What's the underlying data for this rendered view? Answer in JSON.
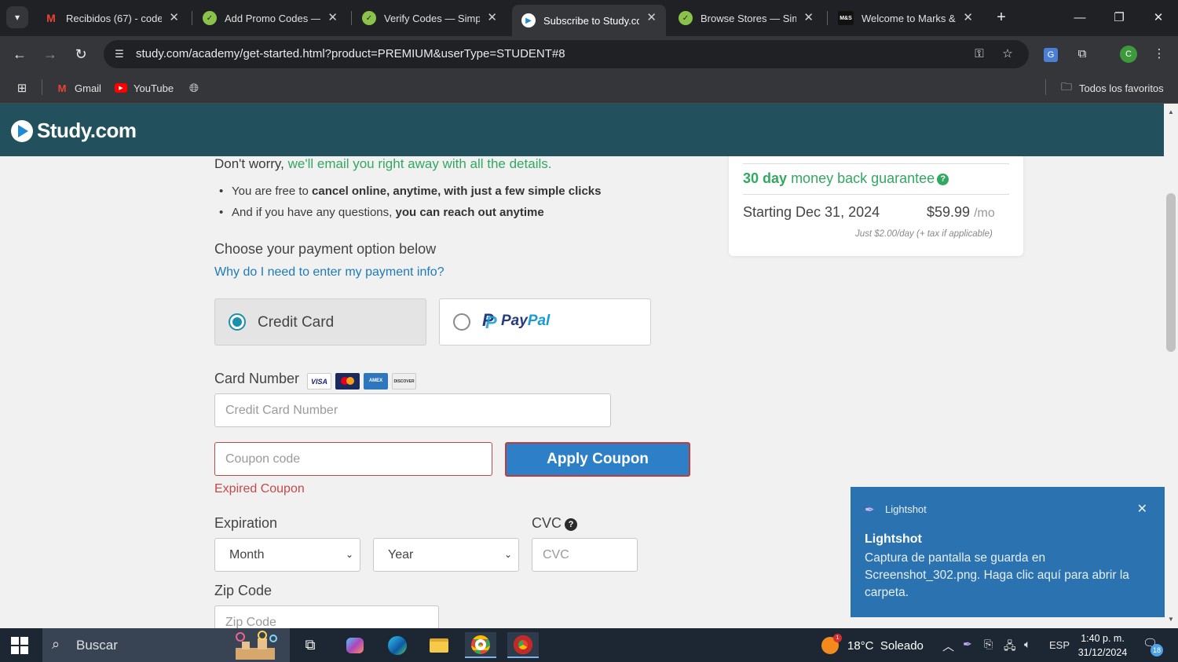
{
  "browser": {
    "tabs": [
      {
        "label": "Recibidos (67) - code",
        "favicon": "gmail-icon"
      },
      {
        "label": "Add Promo Codes — Simp",
        "favicon": "simplycodes-icon"
      },
      {
        "label": "Verify Codes — Simplyc",
        "favicon": "simplycodes-icon"
      },
      {
        "label": "Subscribe to Study.com",
        "favicon": "study-icon"
      },
      {
        "label": "Browse Stores — Simply",
        "favicon": "simplycodes-icon"
      },
      {
        "label": "Welcome to Marks & Sp",
        "favicon": "marks-spencer-icon"
      }
    ],
    "marks_favicon_text": "M&S",
    "url": "study.com/academy/get-started.html?product=PREMIUM&userType=STUDENT#8",
    "profile_initial": "C",
    "bookmarks": [
      {
        "label": "Gmail"
      },
      {
        "label": "YouTube"
      }
    ],
    "all_bookmarks_label": "Todos los favoritos"
  },
  "site": {
    "logo_text": "Study.com"
  },
  "left": {
    "intro_plain": "Don't worry, ",
    "intro_green": "we'll email you right away with all the details.",
    "bullet1_plain": "You are free to ",
    "bullet1_bold": "cancel online, anytime, with just a few simple clicks",
    "bullet2_plain": "And if you have any questions, ",
    "bullet2_bold": "you can reach out anytime",
    "payment_heading": "Choose your payment option below",
    "payment_info_link": "Why do I need to enter my payment info?",
    "option_credit_card": "Credit Card",
    "option_paypal_pay": "Pay",
    "option_paypal_pal": "Pal",
    "card_number_label": "Card Number",
    "card_logos": [
      "VISA",
      "MC",
      "AMEX",
      "DISCOVER"
    ],
    "card_number_placeholder": "Credit Card Number",
    "coupon_placeholder": "Coupon code",
    "apply_button": "Apply Coupon",
    "coupon_error": "Expired Coupon",
    "expiration_label": "Expiration",
    "month_value": "Month",
    "year_value": "Year",
    "cvc_label": "CVC",
    "cvc_placeholder": "CVC",
    "zip_label": "Zip Code",
    "zip_placeholder": "Zip Code"
  },
  "summary": {
    "guarantee_bold": "30 day",
    "guarantee_rest": "money back guarantee",
    "starting": "Starting Dec 31, 2024",
    "price": "$59.99",
    "price_unit": "/mo",
    "per_day_note": "Just $2.00/day (+ tax if applicable)"
  },
  "toast": {
    "app_name": "Lightshot",
    "title": "Lightshot",
    "body": "Captura de pantalla se guarda en Screenshot_302.png. Haga clic aquí para abrir la carpeta."
  },
  "taskbar": {
    "search_label": "Buscar",
    "weather": "18°C  Soleado",
    "weather_badge": "1",
    "language": "ESP",
    "time": "1:40 p. m.",
    "date": "31/12/2024",
    "notification_count": "18"
  },
  "colors": {
    "header_bg": "#22505c",
    "accent_green": "#32a860",
    "link_blue": "#1d7bb8",
    "apply_button": "#2d7fc7",
    "error_red": "#c24a4a",
    "toast_bg": "#2b73b0"
  }
}
